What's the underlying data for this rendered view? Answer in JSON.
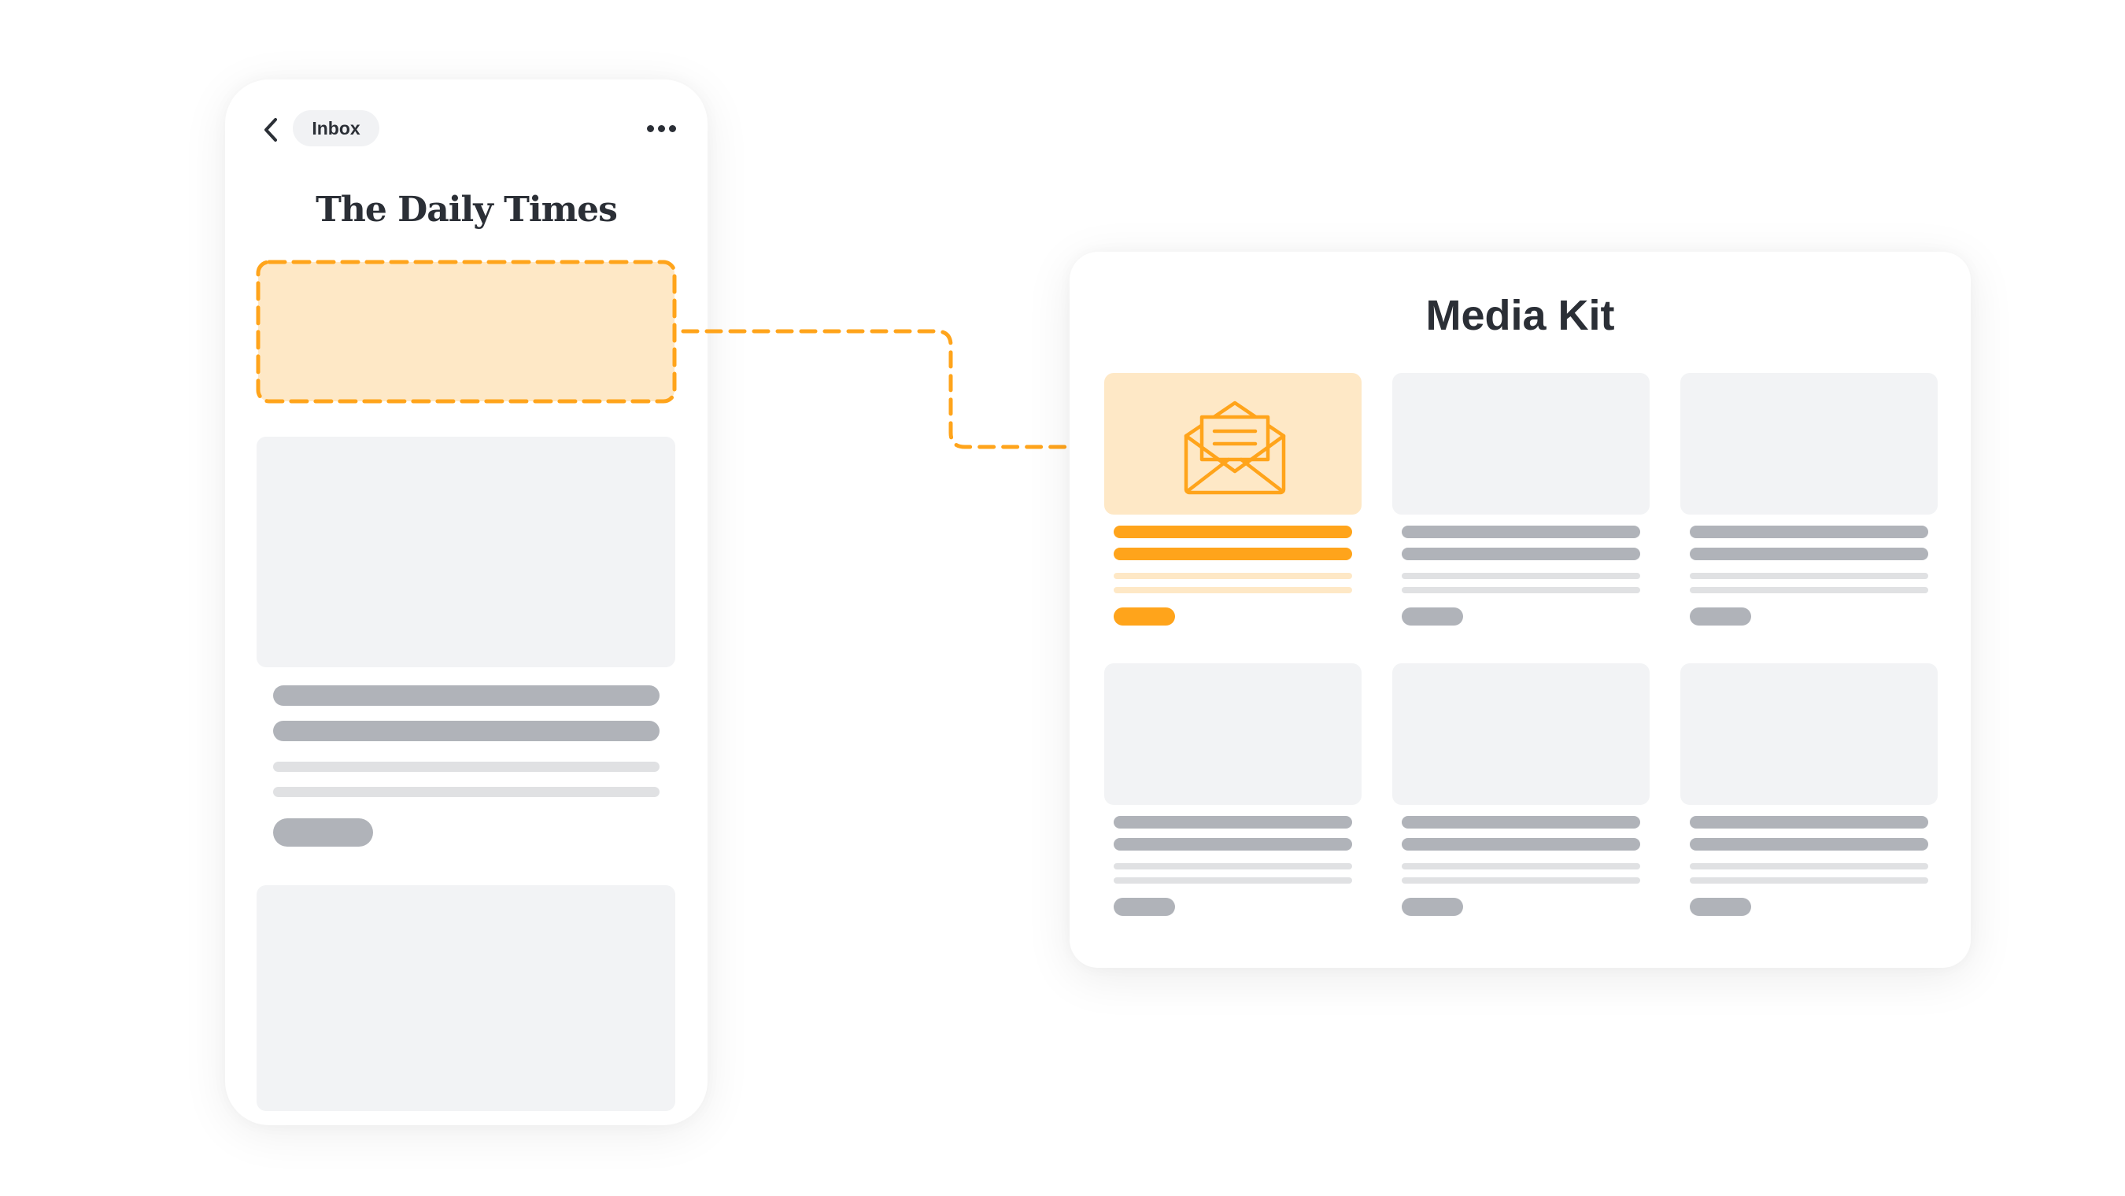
{
  "colors": {
    "accent": "#ffa41b",
    "accent_light": "#fee8c6",
    "placeholder_bg": "#f2f3f5",
    "placeholder_bar": "#b0b3b9",
    "placeholder_line": "#e0e1e3",
    "text": "#2b2f36"
  },
  "phone": {
    "back_icon": "chevron-left-icon",
    "inbox_label": "Inbox",
    "more_icon": "more-horizontal-icon",
    "masthead": "The Daily Times",
    "ad_slot": "highlighted-ad-placement"
  },
  "connector": {
    "icon": "dashed-arrow-right-icon"
  },
  "media_kit": {
    "title": "Media Kit",
    "highlight_icon": "open-envelope-icon",
    "cards": [
      {
        "highlighted": true
      },
      {
        "highlighted": false
      },
      {
        "highlighted": false
      },
      {
        "highlighted": false
      },
      {
        "highlighted": false
      },
      {
        "highlighted": false
      }
    ]
  }
}
